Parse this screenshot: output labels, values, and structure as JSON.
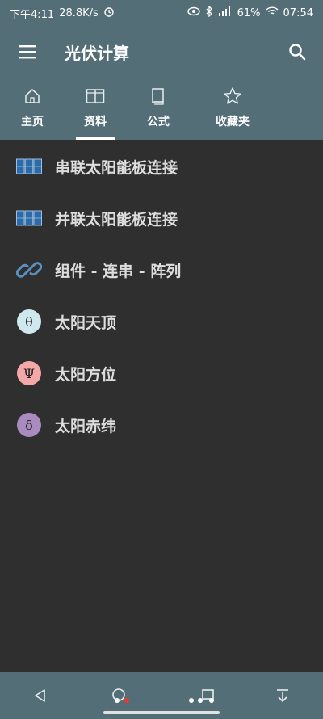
{
  "status_bar": {
    "time": "下午4:11",
    "speed": "28.8K/s",
    "battery": "61%",
    "clock": "07:54"
  },
  "app_bar": {
    "title": "光伏计算"
  },
  "tabs": [
    {
      "label": "主页",
      "icon": "home-icon",
      "active": false
    },
    {
      "label": "资料",
      "icon": "book-open-icon",
      "active": true
    },
    {
      "label": "公式",
      "icon": "book-icon",
      "active": false
    },
    {
      "label": "收藏夹",
      "icon": "star-icon",
      "active": false
    }
  ],
  "items": [
    {
      "label": "串联太阳能板连接",
      "icon": "solar-panel-icon"
    },
    {
      "label": "并联太阳能板连接",
      "icon": "solar-panel-icon"
    },
    {
      "label": "组件 - 连串 - 阵列",
      "icon": "chain-link-icon"
    },
    {
      "label": "太阳天顶",
      "icon": "theta-icon",
      "symbol": "θ",
      "color": "#cfe8ee"
    },
    {
      "label": "太阳方位",
      "icon": "psi-icon",
      "symbol": "Ψ",
      "color": "#f4a8a8"
    },
    {
      "label": "太阳赤纬",
      "icon": "delta-icon",
      "symbol": "δ",
      "color": "#a98bc0"
    }
  ],
  "colors": {
    "header": "#546e78",
    "background": "#2f2f2f",
    "panel_blue": "#2c6aa8"
  }
}
